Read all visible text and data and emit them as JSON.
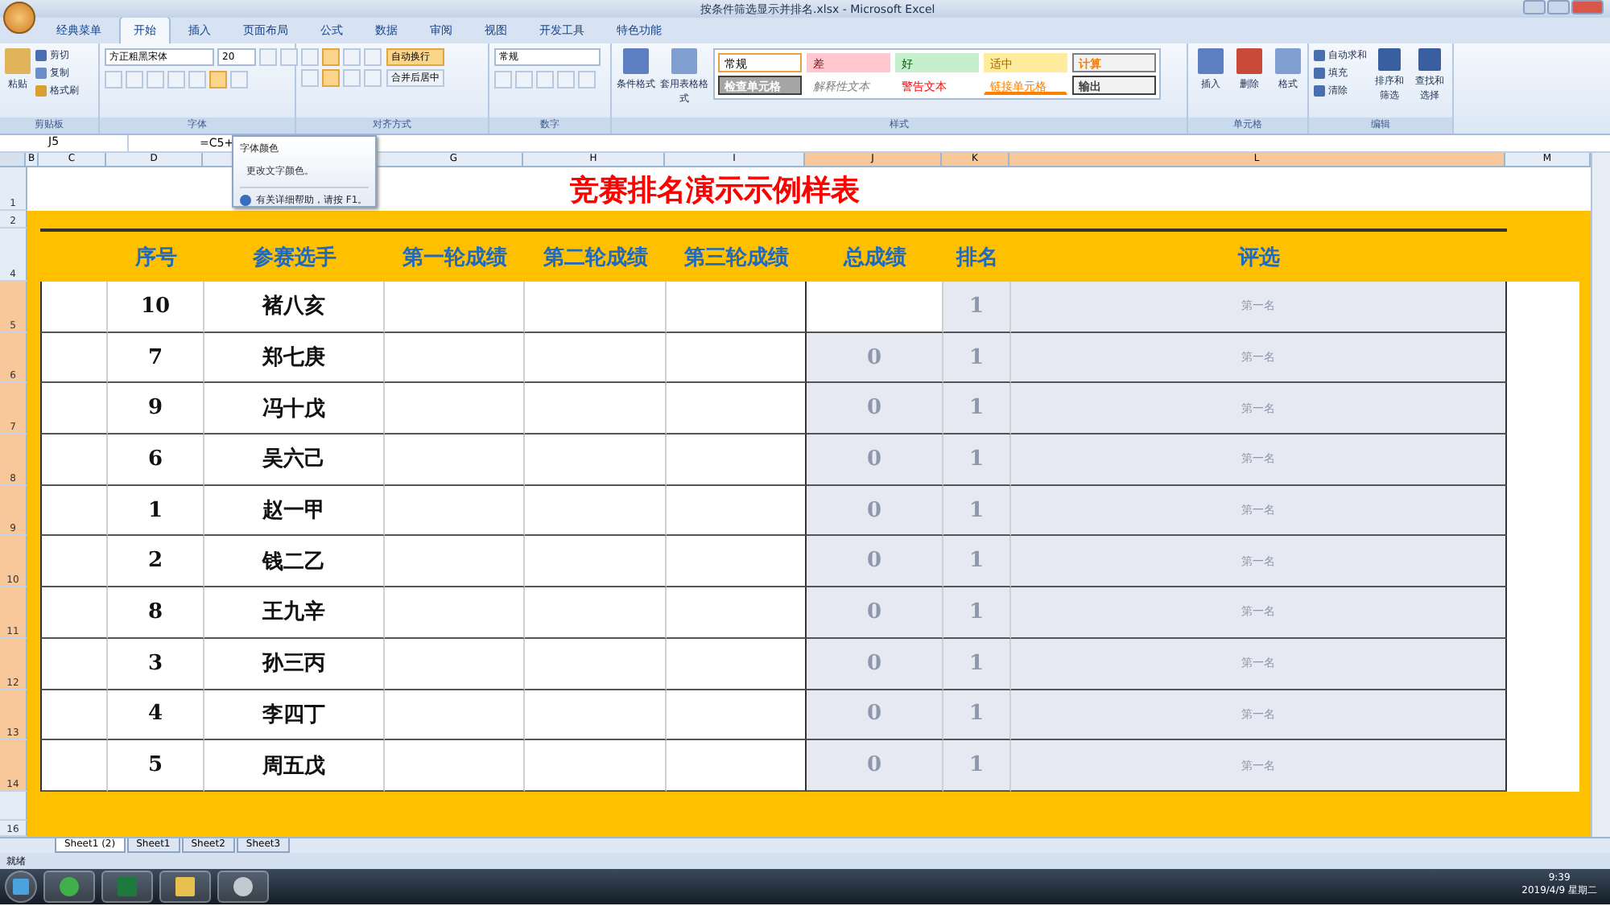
{
  "window": {
    "title": "按条件筛选显示并排名.xlsx - Microsoft Excel"
  },
  "ribbon_tabs": [
    {
      "label": "经典菜单",
      "selected": false
    },
    {
      "label": "开始",
      "selected": true
    },
    {
      "label": "插入",
      "selected": false
    },
    {
      "label": "页面布局",
      "selected": false
    },
    {
      "label": "公式",
      "selected": false
    },
    {
      "label": "数据",
      "selected": false
    },
    {
      "label": "审阅",
      "selected": false
    },
    {
      "label": "视图",
      "selected": false
    },
    {
      "label": "开发工具",
      "selected": false
    },
    {
      "label": "特色功能",
      "selected": false
    }
  ],
  "clipboard": {
    "label": "剪贴板",
    "paste": "粘贴",
    "items": [
      "剪切",
      "复制",
      "格式刷"
    ]
  },
  "font": {
    "label": "字体",
    "name": "方正粗黑宋体",
    "size": "20"
  },
  "alignment": {
    "label": "对齐方式",
    "wrap": "自动换行",
    "merge": "合并后居中"
  },
  "number": {
    "label": "数字",
    "format": "常规"
  },
  "styles": {
    "label": "样式",
    "conditional": "条件格式",
    "table_format": "套用表格格式",
    "gallery": [
      {
        "label": "常规",
        "kind": "normal"
      },
      {
        "label": "差",
        "kind": "bad"
      },
      {
        "label": "好",
        "kind": "good"
      },
      {
        "label": "适中",
        "kind": "neutral"
      },
      {
        "label": "计算",
        "kind": "calc"
      },
      {
        "label": "检查单元格",
        "kind": "check"
      },
      {
        "label": "解释性文本",
        "kind": "explain"
      },
      {
        "label": "警告文本",
        "kind": "warn"
      },
      {
        "label": "链接单元格",
        "kind": "linked"
      },
      {
        "label": "输出",
        "kind": "output"
      }
    ]
  },
  "cells": {
    "label": "单元格",
    "items": [
      "插入",
      "删除",
      "格式"
    ]
  },
  "editing": {
    "label": "编辑",
    "small": [
      "自动求和",
      "填充",
      "清除"
    ],
    "big": [
      "排序和筛选",
      "查找和选择"
    ]
  },
  "formula_bar": {
    "name_box": "J5",
    "formula": "=C5+"
  },
  "tooltip": {
    "title": "字体颜色",
    "description": "更改文字颜色。",
    "help": "有关详细帮助，请按 F1。"
  },
  "column_headers": [
    {
      "label": "B",
      "selected": false
    },
    {
      "label": "C",
      "selected": false
    },
    {
      "label": "D",
      "selected": false
    },
    {
      "label": "G",
      "selected": false
    },
    {
      "label": "H",
      "selected": false
    },
    {
      "label": "I",
      "selected": false
    },
    {
      "label": "J",
      "selected": true
    },
    {
      "label": "K",
      "selected": true
    },
    {
      "label": "L",
      "selected": true
    },
    {
      "label": "M",
      "selected": false
    }
  ],
  "sheet": {
    "title": "竞赛排名演示示例样表",
    "header_row": "4",
    "title_row": "1",
    "band_row": "2",
    "last_row": "16",
    "headers": [
      "序号",
      "参赛选手",
      "第一轮成绩",
      "第二轮成绩",
      "第三轮成绩",
      "总成绩",
      "排名",
      "评选"
    ],
    "rows": [
      {
        "row": "5",
        "seq": "10",
        "name": "褚八亥",
        "rank": "1",
        "eval": "第一名"
      },
      {
        "row": "6",
        "seq": "7",
        "name": "郑七庚",
        "total": "0",
        "rank": "1",
        "eval": "第一名"
      },
      {
        "row": "7",
        "seq": "9",
        "name": "冯十戊",
        "total": "0",
        "rank": "1",
        "eval": "第一名"
      },
      {
        "row": "8",
        "seq": "6",
        "name": "吴六己",
        "total": "0",
        "rank": "1",
        "eval": "第一名"
      },
      {
        "row": "9",
        "seq": "1",
        "name": "赵一甲",
        "total": "0",
        "rank": "1",
        "eval": "第一名"
      },
      {
        "row": "10",
        "seq": "2",
        "name": "钱二乙",
        "total": "0",
        "rank": "1",
        "eval": "第一名"
      },
      {
        "row": "11",
        "seq": "8",
        "name": "王九辛",
        "total": "0",
        "rank": "1",
        "eval": "第一名"
      },
      {
        "row": "12",
        "seq": "3",
        "name": "孙三丙",
        "total": "0",
        "rank": "1",
        "eval": "第一名"
      },
      {
        "row": "13",
        "seq": "4",
        "name": "李四丁",
        "total": "0",
        "rank": "1",
        "eval": "第一名"
      },
      {
        "row": "14",
        "seq": "5",
        "name": "周五戊",
        "total": "0",
        "rank": "1",
        "eval": "第一名"
      }
    ]
  },
  "sheet_tabs": [
    {
      "label": "Sheet1 (2)",
      "selected": true
    },
    {
      "label": "Sheet1",
      "selected": false
    },
    {
      "label": "Sheet2",
      "selected": false
    },
    {
      "label": "Sheet3",
      "selected": false
    }
  ],
  "status_bar": {
    "status": "就绪"
  },
  "taskbar": {
    "time": "9:39",
    "date": "2019/4/9 星期二"
  }
}
